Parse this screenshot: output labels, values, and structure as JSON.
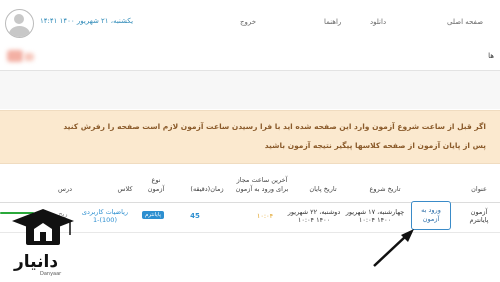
{
  "header": {
    "date": "یکشنبه، ۲۱ شهریور ۱۴۰۰ ۱۴:۴۱",
    "nav": [
      "صفحه اصلی",
      "دانلود",
      "راهنما",
      "خروج"
    ]
  },
  "subheader": {
    "text": "ها"
  },
  "notice": {
    "line1": "اگر قبل از ساعت شروع آزمون وارد این صفحه شده اید با فرا رسیدن ساعت آزمون لازم است صفحه را رفرش کنید",
    "line2": "پس از پایان آزمون از صفحه کلاسها پیگیر نتیجه آزمون باشید"
  },
  "table": {
    "headers": {
      "title": "عنوان",
      "start_date": "تاریخ شروع",
      "end_date": "تاریخ پایان",
      "last_entry": "آخرین ساعت مجاز برای ورود به آزمون",
      "duration": "زمان(دقیقه)",
      "type": "نوع آزمون",
      "class": "کلاس",
      "course": "درس"
    },
    "row": {
      "title": "آزمون پایانترم",
      "start_date": "چهارشنبه، ۱۷ شهریور ۱۴۰۰ ۱۰:۰۴",
      "end_date": "دوشنبه، ۲۲ شهریور ۱۴۰۰ ۱۰:۰۴",
      "last_entry": "۱۰:۰۴",
      "duration": "45",
      "type": "پایانترم",
      "class": "ریاضیات کاربردی (100)-1",
      "course": "ریح"
    },
    "action": "ورود به آزمون"
  },
  "watermark": {
    "name": "دانیار",
    "sub": "Danyaar"
  }
}
